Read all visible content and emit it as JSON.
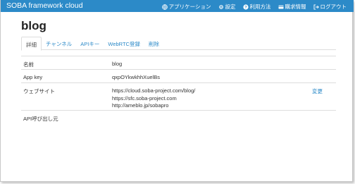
{
  "navbar": {
    "brand": "SOBA framework cloud",
    "items": [
      {
        "label": "アプリケーション",
        "icon": "globe-icon"
      },
      {
        "label": "設定",
        "icon": "gear-icon"
      },
      {
        "label": "利用方法",
        "icon": "question-icon"
      },
      {
        "label": "購求情報",
        "icon": "card-icon"
      },
      {
        "label": "ログアウト",
        "icon": "logout-icon"
      }
    ]
  },
  "page": {
    "title": "blog"
  },
  "tabs": [
    "詳細",
    "チャンネル",
    "APIキー",
    "WebRTC登録",
    "削除"
  ],
  "details": {
    "rows": [
      {
        "label": "名前",
        "value": "blog"
      },
      {
        "label": "App key",
        "value": "qxpOYkwkhhXuelBs"
      },
      {
        "label": "ウェブサイト",
        "values": [
          "https://cloud.soba-project.com/blog/",
          "https://sfc.soba-project.com",
          "http://ameblo.jp/sobapro"
        ],
        "action": "変更"
      },
      {
        "label": "API呼び出し元",
        "value": ""
      }
    ]
  }
}
